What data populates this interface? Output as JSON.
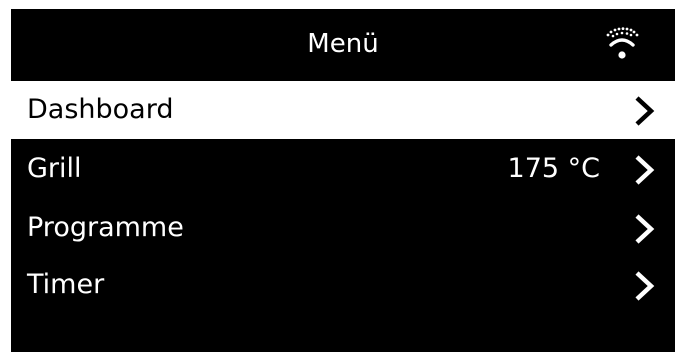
{
  "header": {
    "title": "Menü",
    "status_icon": "wifi-icon"
  },
  "menu": {
    "items": [
      {
        "label": "Dashboard",
        "value": "",
        "selected": true
      },
      {
        "label": "Grill",
        "value": "175 °C",
        "selected": false
      },
      {
        "label": "Programme",
        "value": "",
        "selected": false
      },
      {
        "label": "Timer",
        "value": "",
        "selected": false
      }
    ]
  },
  "colors": {
    "background": "#000000",
    "foreground": "#ffffff",
    "selected_background": "#ffffff",
    "selected_foreground": "#000000"
  }
}
